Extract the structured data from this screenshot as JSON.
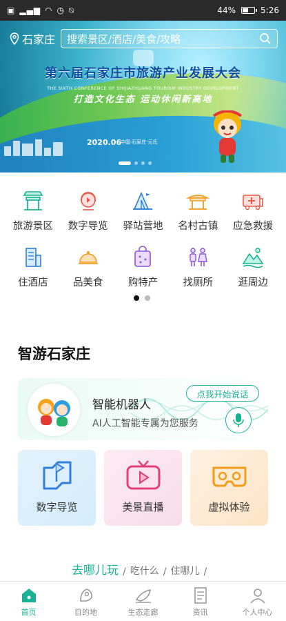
{
  "status_bar": {
    "battery": "44%",
    "time": "5:26",
    "battery_level": 0.44
  },
  "banner": {
    "city": "石家庄",
    "search_placeholder": "搜索景区/酒店/美食/攻略",
    "title": "第六届石家庄市旅游产业发展大会",
    "subtitle": "THE SIXTH CONFERENCE OF SHIJIAZHUANG TOURISM INDUSTRY DEVELOPMENT",
    "slogan": "打造文化生态 运动休闲新高地",
    "date": "2020.06",
    "place": "中国·石家庄·元氏",
    "slide_count": 4,
    "active_slide": 1
  },
  "services": [
    {
      "label": "旅游景区",
      "icon": "scenic-gate-icon"
    },
    {
      "label": "数字导览",
      "icon": "headphones-guide-icon"
    },
    {
      "label": "驿站营地",
      "icon": "tent-camp-icon"
    },
    {
      "label": "名村古镇",
      "icon": "ancient-pavilion-icon"
    },
    {
      "label": "应急救援",
      "icon": "ambulance-icon"
    },
    {
      "label": "住酒店",
      "icon": "hotel-building-icon"
    },
    {
      "label": "品美食",
      "icon": "food-cloche-icon"
    },
    {
      "label": "购特产",
      "icon": "specialty-bag-icon"
    },
    {
      "label": "找厕所",
      "icon": "restroom-icon"
    },
    {
      "label": "逛周边",
      "icon": "mountain-scenery-icon"
    }
  ],
  "services_pager": {
    "pages": 2,
    "active": 1
  },
  "smart_section": {
    "title": "智游石家庄",
    "robot": {
      "name": "智能机器人",
      "desc": "AI人工智能专属为您服务",
      "tap_label": "点我开始说话"
    },
    "features": [
      {
        "label": "数字导览",
        "icon": "digital-map-icon"
      },
      {
        "label": "美景直播",
        "icon": "live-tv-icon"
      },
      {
        "label": "虚拟体验",
        "icon": "vr-glasses-icon"
      }
    ]
  },
  "tabs": [
    "去哪儿玩",
    "吃什么",
    "住哪儿"
  ],
  "bottom_nav": [
    {
      "label": "首页",
      "icon": "home-icon",
      "active": true
    },
    {
      "label": "目的地",
      "icon": "destination-icon",
      "active": false
    },
    {
      "label": "生态走廊",
      "icon": "eco-corridor-icon",
      "active": false
    },
    {
      "label": "资讯",
      "icon": "news-icon",
      "active": false
    },
    {
      "label": "个人中心",
      "icon": "profile-icon",
      "active": false
    }
  ],
  "colors": {
    "accent": "#19b394",
    "banner_title": "#0d4f9e"
  }
}
